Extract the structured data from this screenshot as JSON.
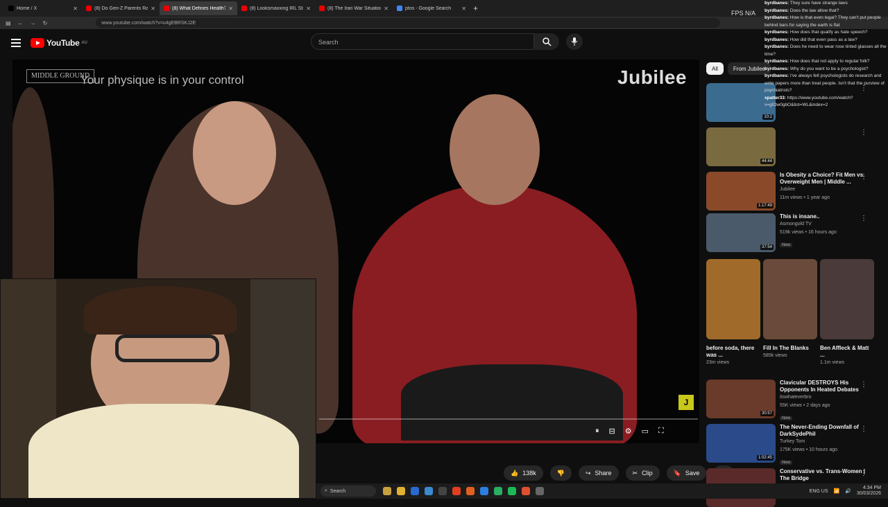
{
  "tabs": [
    {
      "label": "Home / X",
      "color": "#000"
    },
    {
      "label": "(8) Do Gen-Z Parents Raise Soft",
      "color": "#e00"
    },
    {
      "label": "(8) What Defines Health? Fit Vs",
      "color": "#e00",
      "active": true
    },
    {
      "label": "(8) Looksmaxxing IRL Streamer",
      "color": "#e00"
    },
    {
      "label": "(8) The Iran War Situation Is Cr",
      "color": "#e00"
    },
    {
      "label": "ptos - Google Search",
      "color": "#4285f4"
    }
  ],
  "address": {
    "url": "www.youtube.com/watch?v=u4gEBRSKJ2E"
  },
  "youtube": {
    "logo": "YouTube",
    "region": "AU",
    "search_placeholder": "Search"
  },
  "video": {
    "badge": "MIDDLE GROUND",
    "title": "Your physique is in your control",
    "brand": "Jubilee",
    "jbadge": "J"
  },
  "actions": {
    "likes": "138k",
    "share": "Share",
    "clip": "Clip",
    "save": "Save"
  },
  "sidebar": {
    "chips": [
      "All",
      "From Jubilee"
    ],
    "recs": [
      {
        "title": "",
        "channel": "",
        "meta": "",
        "dur": "10:2",
        "color": "#3b6b8f"
      },
      {
        "title": "",
        "channel": "",
        "meta": "",
        "dur": "44:44",
        "color": "#7a6a3f"
      },
      {
        "title": "Is Obesity a Choice? Fit Men vs. Overweight Men | Middle ...",
        "channel": "Jubilee",
        "meta": "11m views • 1 year ago",
        "dur": "1:17:49",
        "color": "#8a4a2a"
      },
      {
        "title": "This is insane..",
        "channel": "Asmongold TV",
        "meta": "519k views • 16 hours ago",
        "dur": "37:54",
        "color": "#4a5a6a",
        "new": "New"
      },
      {
        "title": "Clavicular DESTROYS His Opponents In Heated Debates",
        "channel": "itswhateverbro",
        "meta": "55K views • 2 days ago",
        "dur": "30:57",
        "color": "#6a3a2a",
        "new": "New"
      },
      {
        "title": "The Never-Ending Downfall of DarkSydePhil",
        "channel": "Turkey Tom",
        "meta": "175K views • 10 hours ago",
        "dur": "1:02:45",
        "color": "#2a4a8a",
        "new": "New"
      },
      {
        "title": "Conservative vs. Trans-Women | The Bridge",
        "channel": "",
        "meta": "",
        "dur": "",
        "color": "#5a2a2a"
      }
    ],
    "shorts": [
      {
        "title": "before soda, there was ...",
        "meta": "23m views",
        "color": "#a06a2a"
      },
      {
        "title": "Fill In The Blanks",
        "meta": "585k views",
        "color": "#6a4a3a"
      },
      {
        "title": "Ben Affleck & Matt ...",
        "meta": "1.1m views",
        "color": "#4a3a3a"
      }
    ]
  },
  "overlay": {
    "fps": "FPS  N/A",
    "na": "N/A",
    "chat": [
      {
        "user": "byrdbanes:",
        "msg": "They sure have strange laws"
      },
      {
        "user": "byrdbanes:",
        "msg": "Does the law allow that?"
      },
      {
        "user": "byrdbanes:",
        "msg": "How is that even legal? They can't put people behind bars for saying the earth is flat"
      },
      {
        "user": "byrdbanes:",
        "msg": "How does that qualify as hate speech?"
      },
      {
        "user": "byrdbanes:",
        "msg": "How did that even pass as a law?"
      },
      {
        "user": "byrdbanes:",
        "msg": "Does he need to wear rose tinted glasses all the time?"
      },
      {
        "user": "byrdbanes:",
        "msg": "How does that not apply to regular folk?"
      },
      {
        "user": "byrdbanes:",
        "msg": "Why do you want to be a psychologist?"
      },
      {
        "user": "byrdbanes:",
        "msg": "I've always felt psychologists do research and write papers more than treat people. Isn't that the purview of psychiatrists?"
      },
      {
        "user": "spatter33:",
        "msg": "https://www.youtube.com/watch?v=gIOw0gbO&list=WL&index=2"
      }
    ]
  },
  "taskbar": {
    "search": "Search",
    "time": "4:34 PM",
    "date": "30/03/2026",
    "lang": "ENG US"
  }
}
